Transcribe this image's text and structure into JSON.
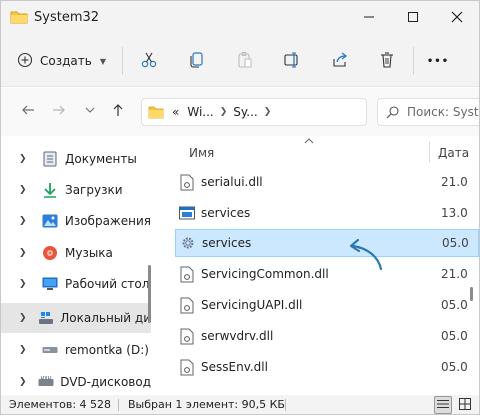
{
  "window": {
    "title": "System32",
    "minimize_icon": "minimize-icon",
    "maximize_icon": "maximize-icon",
    "close_icon": "close-icon"
  },
  "toolbar": {
    "create_label": "Создать",
    "more_label": "•••"
  },
  "address": {
    "prefix": "«",
    "crumbs": [
      "Wi...",
      "Sy..."
    ],
    "search_placeholder": "Поиск: Syst"
  },
  "nav": {
    "items": [
      {
        "label": "Документы",
        "icon": "documents-icon"
      },
      {
        "label": "Загрузки",
        "icon": "downloads-icon"
      },
      {
        "label": "Изображения",
        "icon": "pictures-icon"
      },
      {
        "label": "Музыка",
        "icon": "music-icon"
      },
      {
        "label": "Рабочий стол",
        "icon": "desktop-icon"
      },
      {
        "label": "Локальный ди",
        "icon": "local-disk-icon",
        "selected": true
      },
      {
        "label": "remontka (D:)",
        "icon": "drive-icon"
      },
      {
        "label": "DVD-дисковод",
        "icon": "dvd-icon"
      }
    ]
  },
  "columns": {
    "name": "Имя",
    "date": "Дата"
  },
  "files": [
    {
      "name": "serialui.dll",
      "date": "21.0",
      "icon": "dll-file-icon"
    },
    {
      "name": "services",
      "date": "13.0",
      "icon": "exe-file-icon"
    },
    {
      "name": "services",
      "date": "05.0",
      "icon": "gear-file-icon",
      "selected": true
    },
    {
      "name": "ServicingCommon.dll",
      "date": "21.0",
      "icon": "dll-file-icon"
    },
    {
      "name": "ServicingUAPI.dll",
      "date": "05.0",
      "icon": "dll-file-icon"
    },
    {
      "name": "serwvdrv.dll",
      "date": "05.0",
      "icon": "dll-file-icon"
    },
    {
      "name": "SessEnv.dll",
      "date": "05.0",
      "icon": "dll-file-icon"
    }
  ],
  "status": {
    "count": "Элементов: 4 528",
    "selection": "Выбран 1 элемент: 90,5 КБ"
  },
  "colors": {
    "selection_bg": "#cce8ff",
    "selection_border": "#99d1ff",
    "annotation": "#2a79b0",
    "chrome_bg": "#f3f3f3"
  }
}
